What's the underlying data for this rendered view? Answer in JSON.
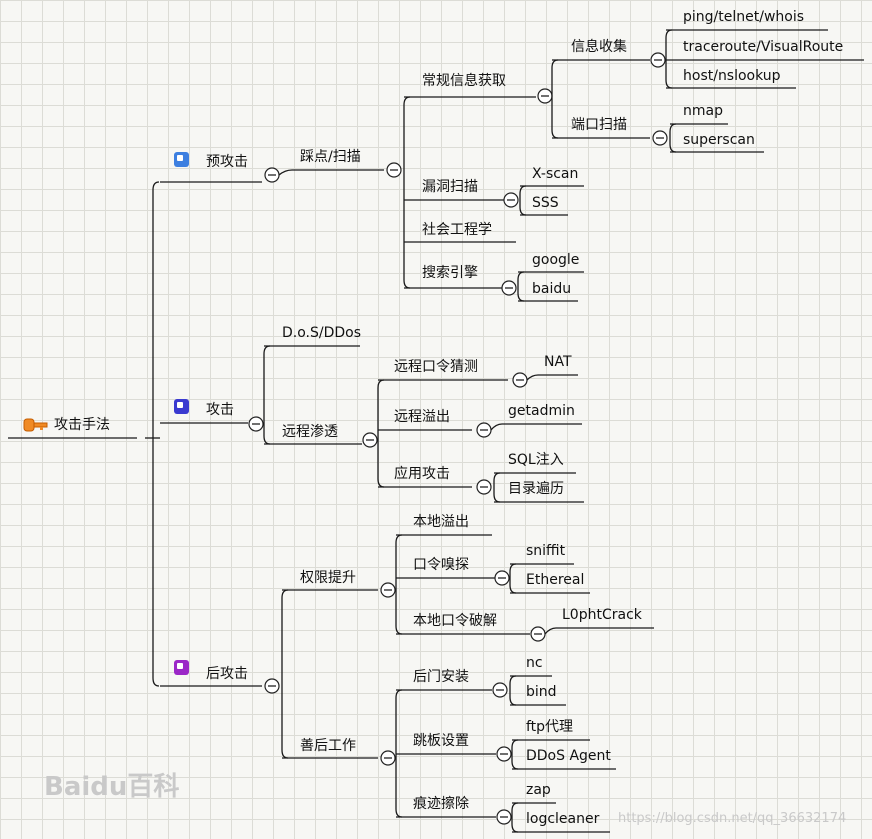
{
  "root": {
    "label": "攻击手法"
  },
  "phases": [
    {
      "label": "预攻击",
      "color": "#3d7fe0"
    },
    {
      "label": "攻击",
      "color": "#3a3ad0"
    },
    {
      "label": "后攻击",
      "color": "#9b27c7"
    }
  ],
  "n": {
    "recon": "踩点/扫描",
    "routine_info": "常规信息获取",
    "info_collect": "信息收集",
    "ping": "ping/telnet/whois",
    "traceroute": "traceroute/VisualRoute",
    "host": "host/nslookup",
    "port_scan": "端口扫描",
    "nmap": "nmap",
    "superscan": "superscan",
    "vuln_scan": "漏洞扫描",
    "xscan": "X-scan",
    "sss": "SSS",
    "social": "社会工程学",
    "search": "搜索引擎",
    "google": "google",
    "baidu": "baidu",
    "dos": "D.o.S/DDos",
    "remote_pen": "远程渗透",
    "pw_guess": "远程口令猜测",
    "nat": "NAT",
    "remote_overflow": "远程溢出",
    "getadmin": "getadmin",
    "app_attack": "应用攻击",
    "sqli": "SQL注入",
    "dir_traverse": "目录遍历",
    "privesc": "权限提升",
    "local_overflow": "本地溢出",
    "pw_sniff": "口令嗅探",
    "sniffit": "sniffit",
    "ethereal": "Ethereal",
    "local_crack": "本地口令破解",
    "l0pht": "L0phtCrack",
    "aftermath": "善后工作",
    "backdoor": "后门安装",
    "nc": "nc",
    "bind": "bind",
    "pivot": "跳板设置",
    "ftp_proxy": "ftp代理",
    "ddos_agent": "DDoS Agent",
    "erase": "痕迹擦除",
    "zap": "zap",
    "logcleaner": "logcleaner"
  },
  "watermark": {
    "logo": "Baidu百科",
    "url": "https://blog.csdn.net/qq_36632174"
  }
}
